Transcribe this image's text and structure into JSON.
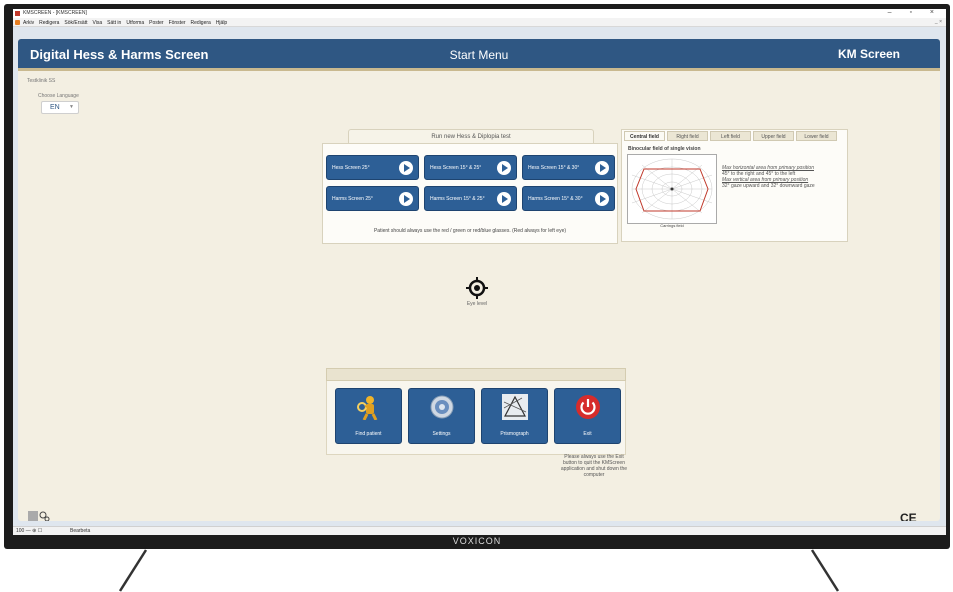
{
  "window": {
    "title": "KMSCREEN - [KMSCREEN]",
    "controls": "– ▫ ×",
    "restore": "_ ×"
  },
  "menubar": {
    "items": [
      "Arkiv",
      "Redigera",
      "Sök/Ersätt",
      "Visa",
      "Sätt in",
      "Utforma",
      "Poster",
      "Fönster",
      "Redigera",
      "Hjälp"
    ]
  },
  "header": {
    "left": "Digital Hess & Harms Screen",
    "center": "Start Menu",
    "right": "KM Screen"
  },
  "clinic": "Testklinik SS",
  "language": {
    "label": "Choose Language",
    "value": "EN"
  },
  "hess": {
    "tab_title": "Run new Hess & Diplopia test",
    "buttons": [
      "Hess Screen 25°",
      "Hess Screen 15° & 25°",
      "Hess Screen 15° & 30°",
      "Harms Screen 25°",
      "Harms Screen 15° & 25°",
      "Harms Screen 15° & 30°"
    ],
    "note": "Patient should always use the red / green or red/blue glasses. (Red always for left eye)"
  },
  "field": {
    "tabs": [
      "Central field",
      "Right field",
      "Left field",
      "Upper field",
      "Lower field"
    ],
    "title": "Binocular field of single vision",
    "caption": "Carrings field",
    "text_line1": "Max horizontal area from primary position",
    "text_line2": "45° to the right and 45° to the left",
    "text_line3": "Max vertical area from primary position",
    "text_line4": "32° gaze upward and 32° downward gaze"
  },
  "eye_level": "Eye level",
  "bottom": {
    "buttons": [
      "Find patient",
      "Settings",
      "Prismograph",
      "Exit"
    ],
    "exit_note": "Please always use the Exit button to quit the KMScreen application and shut down the computer"
  },
  "ce_mark": "CE",
  "statusbar": {
    "zoom": "100 — ⊕ ☐",
    "mode": "Bearbeta"
  },
  "brand": "VOXICON",
  "colors": {
    "header_blue": "#2f5783",
    "button_blue": "#2d5f96",
    "panel_beige": "#f3efe2",
    "exit_red": "#d62c2c",
    "field_red": "#c0392b"
  }
}
